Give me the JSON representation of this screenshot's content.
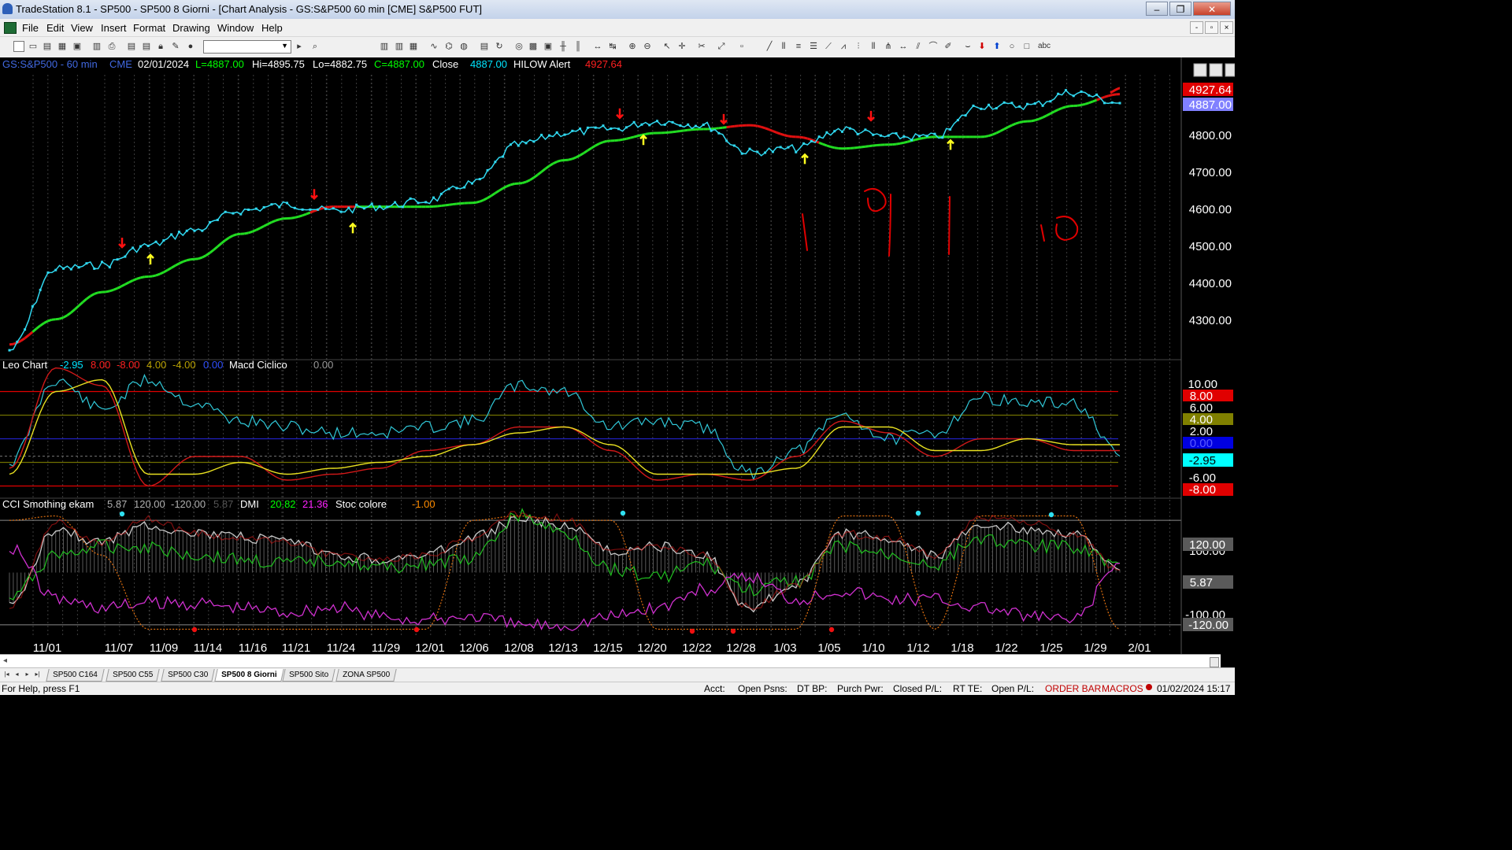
{
  "window": {
    "title": "TradeStation 8.1 - SP500 - SP500 8 Giorni - [Chart Analysis - GS:S&P500  60 min  [CME] S&P500 FUT]",
    "controls": {
      "minimize": "–",
      "restore": "❐",
      "close": "✕"
    }
  },
  "menu": {
    "items": [
      "File",
      "Edit",
      "View",
      "Insert",
      "Format",
      "Drawing",
      "Window",
      "Help"
    ],
    "mdi_controls": {
      "minimize": "-",
      "restore": "▫",
      "close": "×"
    }
  },
  "toolbar": {
    "combo_value": ""
  },
  "chart": {
    "header": {
      "symbol": "GS:S&P500 - 60 min",
      "exchange": "CME",
      "date": "02/01/2024",
      "last": "L=4887.00",
      "high": "Hi=4895.75",
      "low": "Lo=4882.75",
      "close_label": "C=4887.00",
      "close_text": "Close",
      "close_value": "4887.00",
      "alert_name": "HILOW Alert",
      "alert_value": "4927.64"
    },
    "price_axis": [
      "4800.00",
      "4700.00",
      "4600.00",
      "4500.00",
      "4400.00",
      "4300.00"
    ],
    "price_tags": {
      "alert": "4927.64",
      "close": "4887.00"
    },
    "date_axis": [
      "11/01",
      "11/07",
      "11/09",
      "11/14",
      "11/16",
      "11/21",
      "11/24",
      "11/29",
      "12/01",
      "12/06",
      "12/08",
      "12/13",
      "12/15",
      "12/20",
      "12/22",
      "12/28",
      "1/03",
      "1/05",
      "1/10",
      "1/12",
      "1/18",
      "1/22",
      "1/25",
      "1/29",
      "2/01"
    ],
    "annotations": [
      "1",
      "9",
      "1",
      "10"
    ],
    "leo_panel": {
      "title": "Leo Chart",
      "values": [
        "-2.95",
        "8.00",
        "-8.00",
        "4.00",
        "-4.00",
        "0.00"
      ],
      "macd_title": "Macd Ciclico",
      "macd_value": "0.00",
      "axis": [
        "10.00",
        "6.00",
        "2.00",
        "-6.00"
      ],
      "tags": [
        "8.00",
        "4.00",
        "0.00",
        "-2.95",
        "-8.00"
      ]
    },
    "cci_panel": {
      "title": "CCI Smothing ekam",
      "values": [
        "5.87",
        "120.00",
        "-120.00",
        "5.87"
      ],
      "dmi_title": "DMI",
      "dmi_plus": "20.82",
      "dmi_minus": "21.36",
      "stoc_title": "Stoc colore",
      "stoc_value": "-1.00",
      "axis": [
        "100.00",
        "-100.00"
      ],
      "tags": [
        "120.00",
        "5.87",
        "-120.00"
      ]
    }
  },
  "chart_data": [
    {
      "type": "line",
      "title": "GS:S&P500 - 60 min",
      "x": [
        "11/01",
        "11/07",
        "11/09",
        "11/14",
        "11/16",
        "11/21",
        "11/24",
        "11/29",
        "12/01",
        "12/06",
        "12/08",
        "12/13",
        "12/15",
        "12/20",
        "12/22",
        "12/28",
        "1/03",
        "1/05",
        "1/10",
        "1/12",
        "1/18",
        "1/22",
        "1/25",
        "1/29",
        "2/01"
      ],
      "series": [
        {
          "values": [
            4250,
            4460,
            4470,
            4520,
            4560,
            4610,
            4625,
            4610,
            4620,
            4635,
            4680,
            4780,
            4810,
            4820,
            4840,
            4830,
            4760,
            4770,
            4820,
            4800,
            4800,
            4880,
            4880,
            4915,
            4887
          ]
        },
        {
          "values": [
            4265,
            4330,
            4400,
            4440,
            4485,
            4550,
            4590,
            4620,
            4620,
            4620,
            4630,
            4680,
            4740,
            4790,
            4810,
            4820,
            4830,
            4800,
            4770,
            4780,
            4800,
            4800,
            4840,
            4880,
            4910
          ]
        }
      ],
      "ylim": [
        4230,
        4960
      ]
    },
    {
      "type": "line",
      "title": "Leo Chart",
      "x": [
        "11/01",
        "11/07",
        "11/09",
        "11/14",
        "11/16",
        "11/21",
        "11/24",
        "11/29",
        "12/01",
        "12/06",
        "12/08",
        "12/13",
        "12/15",
        "12/20",
        "12/22",
        "12/28",
        "1/03",
        "1/05",
        "1/10",
        "1/12",
        "1/18",
        "1/22",
        "1/25",
        "1/29",
        "2/01"
      ],
      "series": [
        {
          "values": [
            -4,
            10,
            5,
            10,
            6,
            3,
            2,
            1,
            1,
            2,
            3,
            9,
            8,
            2,
            3,
            2,
            -6,
            -2,
            4,
            0,
            1,
            7,
            6,
            6,
            -2.95
          ]
        },
        {
          "values": [
            -5,
            12,
            9,
            -8,
            -3,
            -3,
            -7,
            -6,
            -5,
            -2,
            -1,
            2,
            2,
            -2,
            -7,
            -6,
            -7,
            -3,
            3,
            1,
            -3,
            0,
            0,
            -2,
            -2
          ]
        },
        {
          "values": [
            -6,
            8,
            10,
            -6,
            -6,
            -4,
            -6,
            -5,
            -4,
            -3,
            -1,
            1,
            2,
            -1,
            -6,
            -6,
            -6,
            -5,
            2,
            2,
            -2,
            -2,
            0,
            -1,
            -1
          ]
        }
      ],
      "ylim": [
        -9,
        11
      ]
    },
    {
      "type": "line",
      "title": "CCI Smothing ekam",
      "x": [
        "11/01",
        "11/07",
        "11/09",
        "11/14",
        "11/16",
        "11/21",
        "11/24",
        "11/29",
        "12/01",
        "12/06",
        "12/08",
        "12/13",
        "12/15",
        "12/20",
        "12/22",
        "12/28",
        "1/03",
        "1/05",
        "1/10",
        "1/12",
        "1/18",
        "1/22",
        "1/25",
        "1/29",
        "2/01"
      ],
      "series": [
        {
          "values": [
            -80,
            100,
            70,
            110,
            90,
            80,
            70,
            40,
            30,
            40,
            80,
            120,
            110,
            50,
            60,
            40,
            -80,
            -30,
            90,
            80,
            40,
            110,
            100,
            90,
            5.87
          ]
        },
        {
          "values": [
            -60,
            40,
            60,
            60,
            40,
            30,
            20,
            30,
            10,
            20,
            30,
            130,
            90,
            10,
            -10,
            20,
            -40,
            -20,
            60,
            40,
            20,
            80,
            60,
            60,
            20.82
          ]
        },
        {
          "values": [
            60,
            -60,
            -80,
            -70,
            -70,
            -80,
            -90,
            -80,
            -100,
            -110,
            -100,
            -120,
            -120,
            -100,
            -80,
            -40,
            -10,
            -60,
            -40,
            -60,
            -60,
            -80,
            -100,
            -110,
            21.36
          ]
        }
      ],
      "ylim": [
        -140,
        140
      ]
    }
  ],
  "tabs": {
    "nav": [
      "|◂",
      "◂",
      "▸",
      "▸|"
    ],
    "items": [
      "SP500 C164",
      "SP500 C55",
      "SP500 C30",
      "SP500 8 Giorni",
      "SP500 Sito",
      "ZONA SP500"
    ],
    "active": "SP500 8 Giorni"
  },
  "status": {
    "help": "For Help, press F1",
    "acct": "Acct:",
    "open_psns": "Open Psns:",
    "dt_bp": "DT BP:",
    "purch_pwr": "Purch Pwr:",
    "closed_pl": "Closed P/L:",
    "rt_te": "RT TE:",
    "open_pl": "Open P/L:",
    "order_bar": "ORDER BAR",
    "macros": "MACROS",
    "datetime": "01/02/2024 15:17"
  }
}
